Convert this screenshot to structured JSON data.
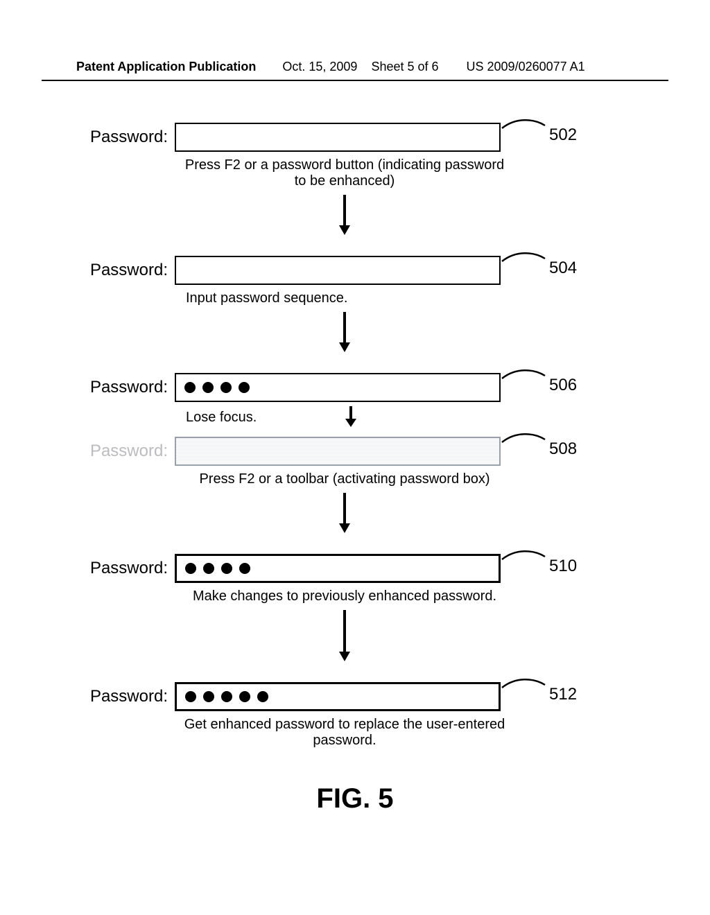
{
  "header": {
    "pubtype": "Patent Application Publication",
    "date": "Oct. 15, 2009",
    "sheet": "Sheet 5 of 6",
    "pubnum": "US 2009/0260077 A1"
  },
  "labels": {
    "password": "Password:"
  },
  "steps": {
    "s502": {
      "ref": "502",
      "caption": "Press F2 or a password button (indicating password to be enhanced)"
    },
    "s504": {
      "ref": "504",
      "caption": "Input password sequence."
    },
    "s506": {
      "ref": "506",
      "caption": "Lose focus.",
      "dots": 4
    },
    "s508": {
      "ref": "508",
      "caption": "Press F2 or a toolbar (activating password box)"
    },
    "s510": {
      "ref": "510",
      "caption": "Make changes to previously enhanced password.",
      "dots": 4
    },
    "s512": {
      "ref": "512",
      "caption": "Get enhanced password to replace the user-entered password.",
      "dots": 5
    }
  },
  "figure": "FIG. 5"
}
